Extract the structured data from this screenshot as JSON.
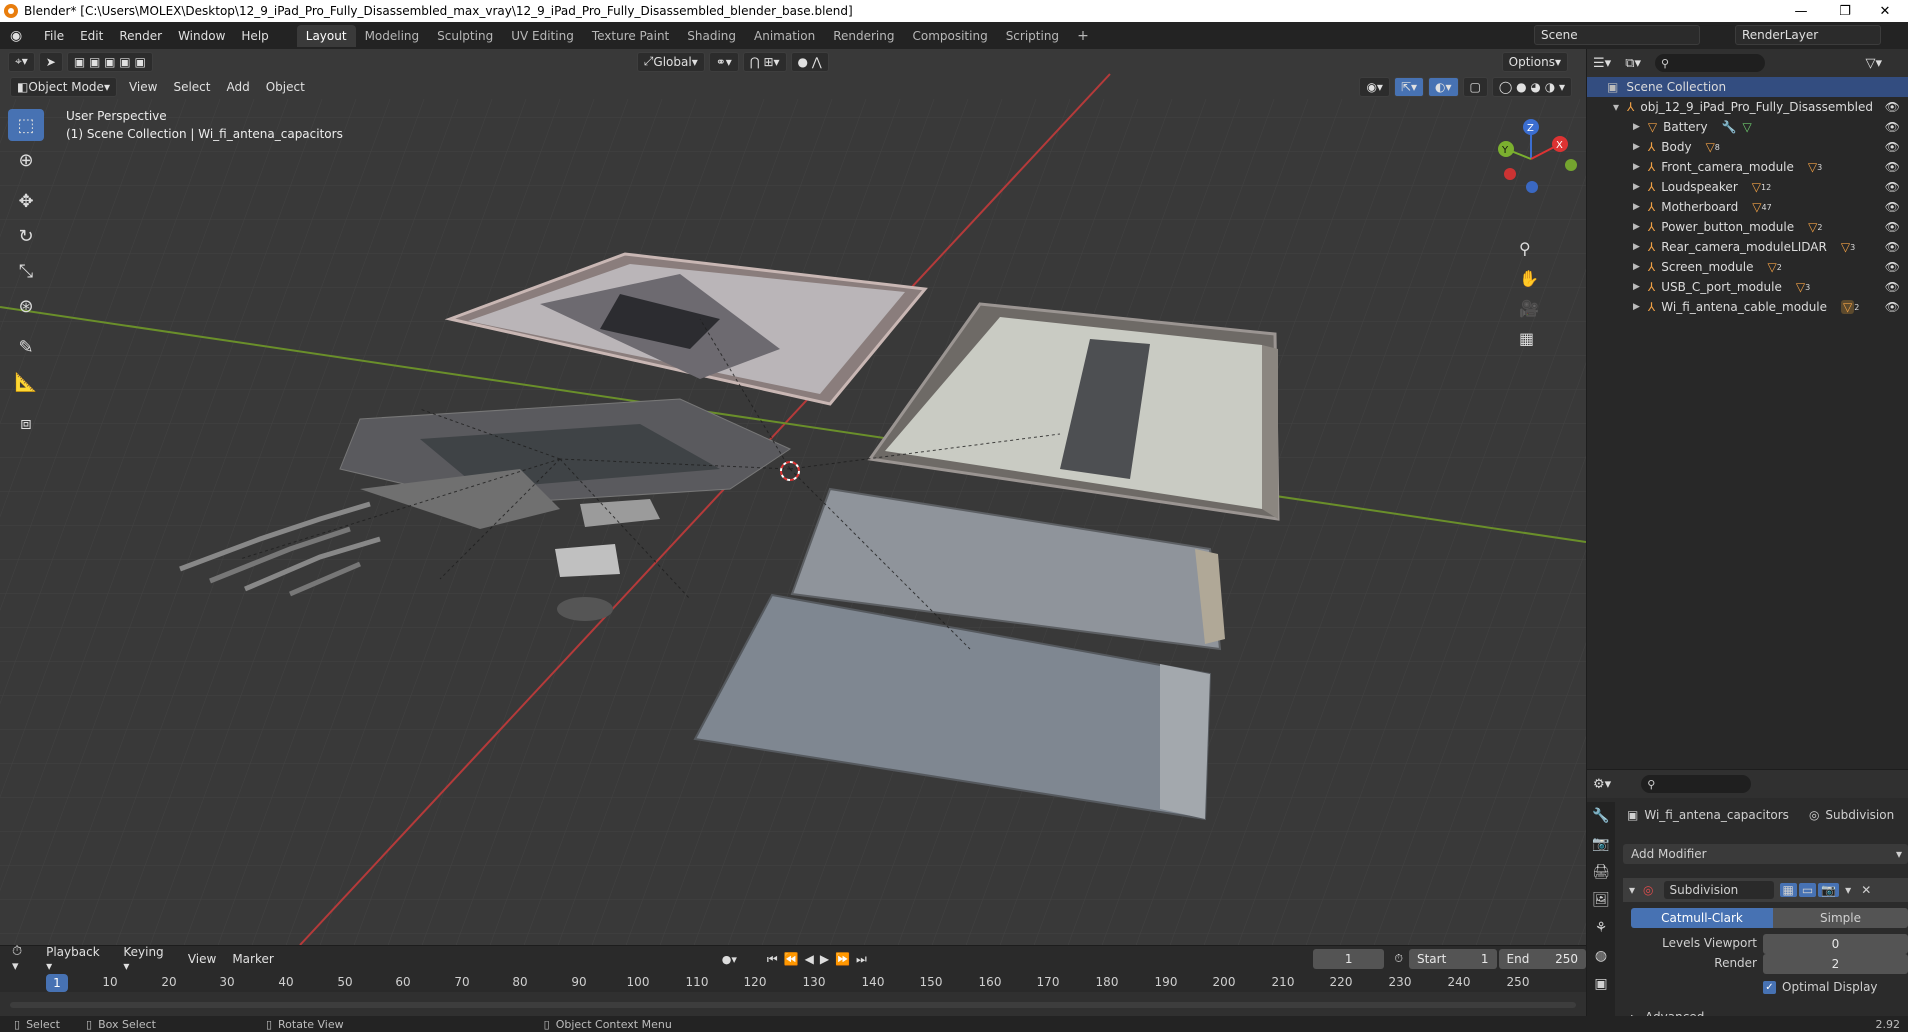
{
  "window": {
    "title": "Blender* [C:\\Users\\MOLEX\\Desktop\\12_9_iPad_Pro_Fully_Disassembled_max_vray\\12_9_iPad_Pro_Fully_Disassembled_blender_base.blend]",
    "minimize": "—",
    "maximize": "❐",
    "close": "✕"
  },
  "menu": [
    "File",
    "Edit",
    "Render",
    "Window",
    "Help"
  ],
  "workspaces": [
    "Layout",
    "Modeling",
    "Sculpting",
    "UV Editing",
    "Texture Paint",
    "Shading",
    "Animation",
    "Rendering",
    "Compositing",
    "Scripting"
  ],
  "active_workspace": "Layout",
  "scene": "Scene",
  "render_layer": "RenderLayer",
  "viewport": {
    "mode": "Object Mode",
    "menus": [
      "View",
      "Select",
      "Add",
      "Object"
    ],
    "transform_orientation": "Global",
    "options": "Options",
    "overlay_line1": "User Perspective",
    "overlay_line2": "(1) Scene Collection | Wi_fi_antena_capacitors"
  },
  "gizmo": {
    "z": "Z",
    "y": "Y",
    "x": "X"
  },
  "outliner": {
    "root": "Scene Collection",
    "object": "obj_12_9_iPad_Pro_Fully_Disassembled",
    "children": [
      {
        "name": "Battery",
        "badge": ""
      },
      {
        "name": "Body",
        "badge": "8"
      },
      {
        "name": "Front_camera_module",
        "badge": "3"
      },
      {
        "name": "Loudspeaker",
        "badge": "12"
      },
      {
        "name": "Motherboard",
        "badge": "47"
      },
      {
        "name": "Power_button_module",
        "badge": "2"
      },
      {
        "name": "Rear_camera_moduleLIDAR",
        "badge": "3"
      },
      {
        "name": "Screen_module",
        "badge": "2"
      },
      {
        "name": "USB_C_port_module",
        "badge": "3"
      },
      {
        "name": "Wi_fi_antena_cable_module",
        "badge": "2"
      }
    ]
  },
  "properties": {
    "object_name": "Wi_fi_antena_capacitors",
    "modifier_tab": "Subdivision",
    "add_modifier": "Add Modifier",
    "modifier_name": "Subdivision",
    "mode_catmull": "Catmull-Clark",
    "mode_simple": "Simple",
    "levels_viewport_label": "Levels Viewport",
    "levels_viewport": "0",
    "render_label": "Render",
    "render_value": "2",
    "optimal_display": "Optimal Display",
    "advanced": "Advanced"
  },
  "timeline": {
    "menus": [
      "Playback",
      "Keying",
      "View",
      "Marker"
    ],
    "current_frame": "1",
    "start_label": "Start",
    "start": "1",
    "end_label": "End",
    "end": "250",
    "ticks": [
      "10",
      "20",
      "30",
      "40",
      "50",
      "60",
      "70",
      "80",
      "90",
      "100",
      "110",
      "120",
      "130",
      "140",
      "150",
      "160",
      "170",
      "180",
      "190",
      "200",
      "210",
      "220",
      "230",
      "240",
      "250"
    ]
  },
  "status": {
    "select": "Select",
    "box_select": "Box Select",
    "rotate_view": "Rotate View",
    "context_menu": "Object Context Menu",
    "version": "2.92"
  }
}
